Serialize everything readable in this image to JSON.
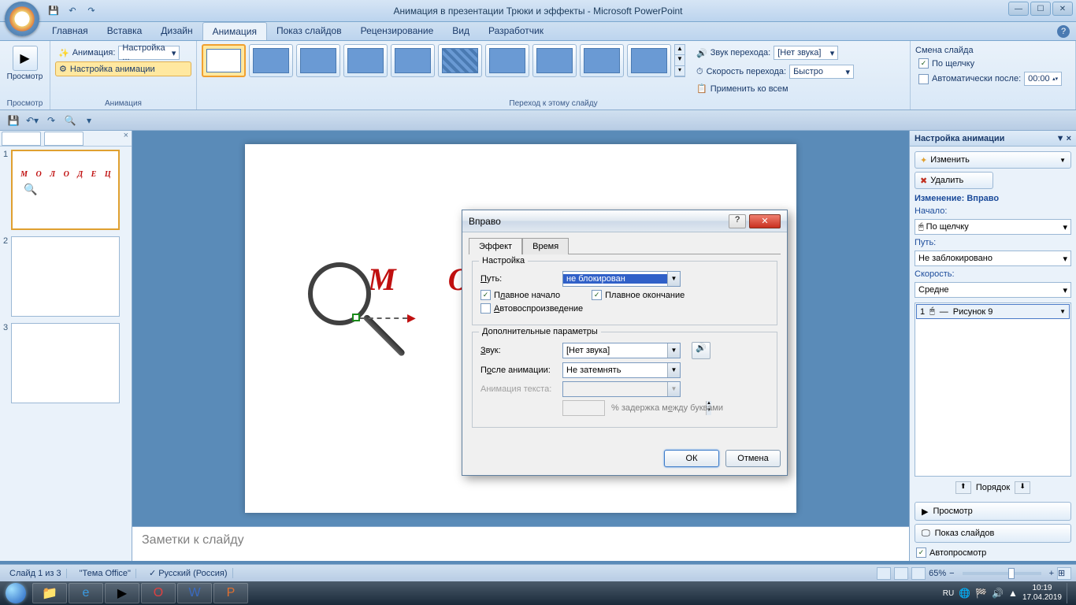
{
  "window": {
    "title": "Анимация в презентации Трюки и эффекты - Microsoft PowerPoint"
  },
  "ribbon": {
    "tabs": [
      "Главная",
      "Вставка",
      "Дизайн",
      "Анимация",
      "Показ слайдов",
      "Рецензирование",
      "Вид",
      "Разработчик"
    ],
    "active_tab": "Анимация",
    "preview_group": {
      "label": "Просмотр",
      "button": "Просмотр"
    },
    "anim_group": {
      "label": "Анимация",
      "animate_label": "Анимация:",
      "animate_value": "Настройка ...",
      "custom_btn": "Настройка анимации"
    },
    "transition_group": {
      "label": "Переход к этому слайду"
    },
    "sound_row": {
      "label": "Звук перехода:",
      "value": "[Нет звука]"
    },
    "speed_row": {
      "label": "Скорость перехода:",
      "value": "Быстро"
    },
    "apply_all": "Применить ко всем",
    "advance_group": {
      "label": "Смена слайда",
      "on_click": "По щелчку",
      "auto_after": "Автоматически после:",
      "auto_value": "00:00"
    }
  },
  "thumbs": {
    "slide1_text": "М О Л О Д Е Ц"
  },
  "slide": {
    "marker": "1",
    "title": "М О Л"
  },
  "notes": {
    "placeholder": "Заметки к слайду"
  },
  "taskpane": {
    "title": "Настройка анимации",
    "change_btn": "Изменить",
    "remove_btn": "Удалить",
    "modify_label": "Изменение: Вправо",
    "start_label": "Начало:",
    "start_value": "По щелчку",
    "path_label": "Путь:",
    "path_value": "Не заблокировано",
    "speed_label": "Скорость:",
    "speed_value": "Средне",
    "list_item": {
      "num": "1",
      "name": "Рисунок 9"
    },
    "order_label": "Порядок",
    "play_btn": "Просмотр",
    "slideshow_btn": "Показ слайдов",
    "autopreview": "Автопросмотр"
  },
  "dialog": {
    "title": "Вправо",
    "tabs": {
      "effect": "Эффект",
      "timing": "Время"
    },
    "settings_legend": "Настройка",
    "path_label": "Путь:",
    "path_value": "не блокирован",
    "smooth_start": "Плавное начало",
    "smooth_end": "Плавное окончание",
    "autoreverse": "Автовоспроизведение",
    "enhance_legend": "Дополнительные параметры",
    "sound_label": "Звук:",
    "sound_value": "[Нет звука]",
    "after_label": "После анимации:",
    "after_value": "Не затемнять",
    "text_label": "Анимация текста:",
    "delay_label": "% задержка между буквами",
    "ok": "ОК",
    "cancel": "Отмена"
  },
  "statusbar": {
    "slide_info": "Слайд 1 из 3",
    "theme": "\"Тема Office\"",
    "lang": "Русский (Россия)",
    "zoom": "65%"
  },
  "taskbar": {
    "lang": "RU",
    "time": "10:19",
    "date": "17.04.2019"
  }
}
